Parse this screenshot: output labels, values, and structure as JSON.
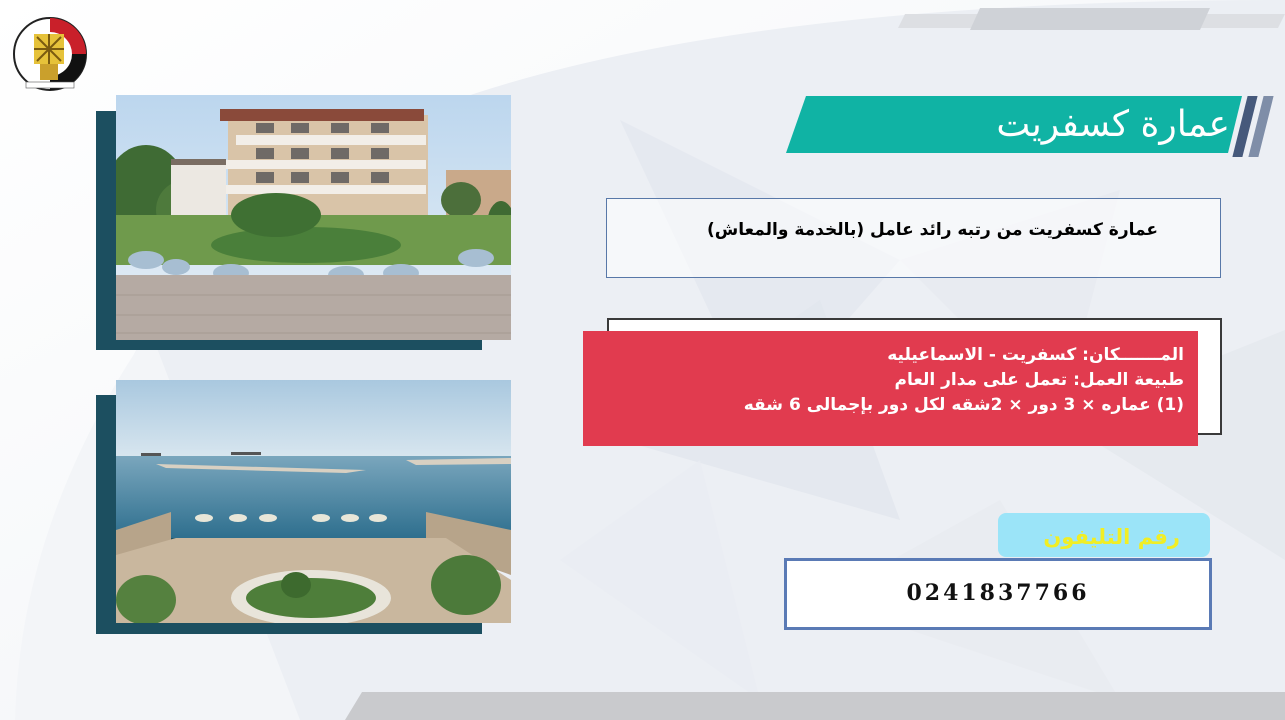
{
  "slide": {
    "title": "عمارة كسفريت",
    "subtitle": "عمارة كسفريت  من رتبه رائد عامل (بالخدمة والمعاش)",
    "info": {
      "location_label": "المـــــــكان",
      "location_value": ": كسفريت  - الاسماعيليه",
      "work_label": "طبيعة العمل",
      "work_value": ": تعمل على مدار العام",
      "building_line": "(1) عماره × 3 دور × 2شقه لكل دور بإجمالى 6 شقه"
    },
    "phone_label": "رقم التليفون",
    "phone_value": "0241837766",
    "photos": [
      {
        "subject": "villa-building-with-garden"
      },
      {
        "subject": "sea-view-terrace-with-umbrellas"
      }
    ],
    "colors": {
      "title_teal": "#10b3a4",
      "stripe_navy": "#46597b",
      "info_red": "#e13b4f",
      "phone_label_bg": "#9be4f8",
      "phone_label_text": "#f1ee24",
      "box_border_blue": "#5a7ab5",
      "photo_shadow": "#1c4f60"
    }
  }
}
